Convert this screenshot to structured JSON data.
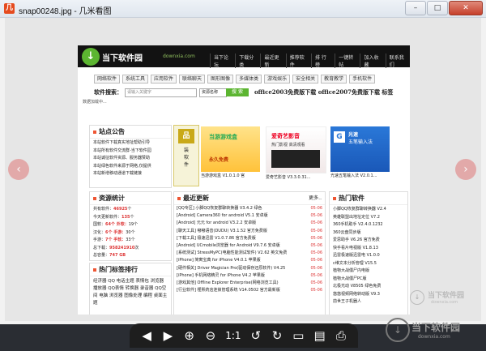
{
  "window": {
    "title": "snap00248.jpg - 几米看图",
    "app_icon": "几",
    "min": "–",
    "max": "□",
    "close": "✕"
  },
  "site": {
    "logo_glyph": "↓",
    "logo_text": "当下软件园",
    "logo_domain": "downxia.com",
    "top_links": [
      "当下论坛",
      "下载分类",
      "最近更新",
      "推荐软件",
      "排 行 榜",
      "一键转帖",
      "加入收藏",
      "联系我们"
    ],
    "nav": [
      "网络软件",
      "系统工具",
      "应用软件",
      "联络聊天",
      "图形图像",
      "多媒体类",
      "游戏娱乐",
      "安全相关",
      "教育教学",
      "手机软件"
    ],
    "search_label": "软件搜索：",
    "search_placeholder": "请输入关键字",
    "search_select": "资源名称",
    "search_button": "搜 索",
    "promo": "office2003免费版下载  office2007免费版下载  标签",
    "loading": "数据加载中...",
    "announce": {
      "title": "站点公告",
      "items": [
        "本站软件下载真实地址帮助引导",
        "本站所有软件交流群-当下软件园",
        "本站诚征软件资源、服务器赞助",
        "本站绿色软件来源于网络,仅提供",
        "本站新增移动通道下载链接"
      ]
    },
    "tiles": [
      {
        "label": "品",
        "sub": "装\n软\n件",
        "cap": ""
      },
      {
        "label": "当游游戏盒",
        "sub": "永久免费",
        "cap": "当游游戏盒 V1.0.1.0 官"
      },
      {
        "label": "爱奇艺影音",
        "sub": "热门影视 高清观看",
        "cap": "爱奇艺影音 V3.3.0.31..."
      },
      {
        "label": "光速",
        "sub": "五笔输入法",
        "cap": "光速五笔输入法 V2.0.1..."
      }
    ],
    "stats": {
      "title": "资源统计",
      "items": [
        [
          "共有软件：",
          "46925",
          "个"
        ],
        [
          "今天更新软件：",
          "135",
          "个"
        ],
        [
          "国软：",
          "64个 外软：",
          "19个"
        ],
        [
          "汉化：",
          "6个 手游：",
          "30个"
        ],
        [
          "手游：",
          "7个 手软：",
          "33个"
        ],
        [
          "总下载：",
          "958241910",
          "次"
        ],
        [
          "总容量：",
          "747 GB",
          ""
        ]
      ]
    },
    "tags": {
      "title": "热门标签排行",
      "text": "经济器 QQ 电话主题 表情包 浏览器 播放器 QQ表情 转换器 录音器 QQ空间 电脑 浏览器 图像处理 编程 桌面主题"
    },
    "news": {
      "title": "最近更新",
      "more": "更多..",
      "rows": [
        [
          "[QQ专区] 小脚QQ恢复群聊转换器 V3.4.2 绿色",
          "05-06"
        ],
        [
          "[Android] Camera360 for android V5.1 安卓版",
          "05-06"
        ],
        [
          "[Android] 元元 for android V3.2.2 安卓版",
          "05-06"
        ],
        [
          "[聊天工具] 嘟嘟语音(DUDU) V3.1.52 官方免费版",
          "05-06"
        ],
        [
          "[下载工具] 极速迅雷 V1.0.7.86 官方免费版",
          "05-06"
        ],
        [
          "[Android] UCmobile浏览器 for Android V9.7.6 安卓版",
          "05-06"
        ],
        [
          "[系统测试] StressMyPC(电脑性能测试软件) V2.62 英文免费",
          "05-06"
        ],
        [
          "[iPhone] 简寓宝典 for iPhone V4.0.1 苹果版",
          "05-06"
        ],
        [
          "[硬件相关] Driver Magician Pro(驱动保存还原软件) V4.25",
          "05-06"
        ],
        [
          "[iPhone] 手机网络精灵 for iPhone V4.2 苹果版",
          "05-06"
        ],
        [
          "[游戏其他] Offline Explorer Enterprise(网络浏览工具)",
          "05-06"
        ],
        [
          "[行业软件] 槿熙药店连锁管理系统 V14.0502 官方最新版",
          "05-06"
        ]
      ]
    },
    "hot": {
      "title": "热门软件",
      "items": [
        "小脚QQ恢复群聊转换器 V2.4",
        "英雄联盟出地址定位 V7.2",
        "360手机助手 V2.4.0.1232",
        "360云盘同步版",
        "爱思助手 V6.26 官方免费",
        "快手看片电视版 V1.8.13",
        "迅雷极速版迅雷电 V1.0.0",
        "c维文本分析管理 V15.5",
        "植物大战僵尸内电版",
        "植物大战僵尸PC版",
        "北极光动 V8505 绿色免费",
        "悠悠视频网络转动版 V9.3",
        "前世王子机器人"
      ]
    }
  },
  "viewer": {
    "prev": "‹",
    "next": "›"
  },
  "toolbar": {
    "prev": "◀",
    "next": "▶",
    "zoom_in": "⊕",
    "zoom_out": "⊖",
    "actual": "1:1",
    "rotate_left": "↺",
    "rotate_right": "↻",
    "folder": "▭",
    "doc": "▤",
    "print": "⎙"
  },
  "watermark": {
    "text": "当下软件园",
    "domain": "downxia.com",
    "glyph": "↓"
  },
  "colors": {
    "accent": "#5cb531",
    "date": "#dd3333"
  }
}
